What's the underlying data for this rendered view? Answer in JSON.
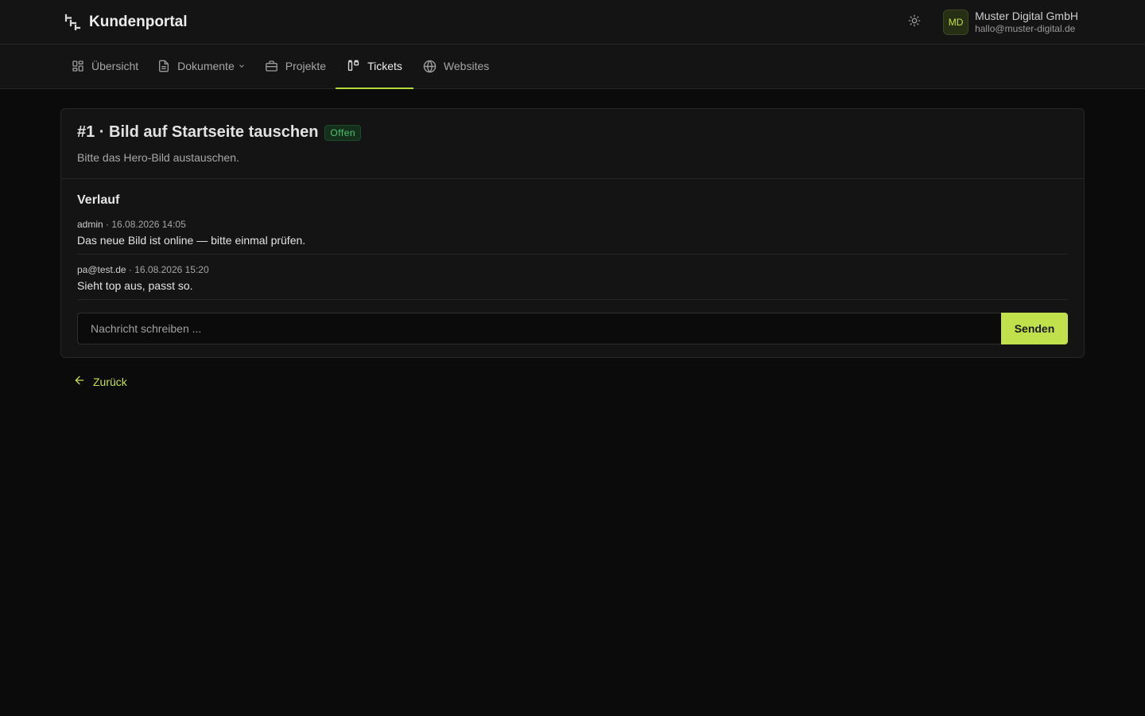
{
  "app": {
    "name": "Kundenportal",
    "logo_icon": "portal-logo-icon",
    "theme_toggle_icon": "sun-icon"
  },
  "user": {
    "initials": "MD",
    "company": "Muster Digital GmbH",
    "email": "hallo@muster-digital.de"
  },
  "nav": {
    "items": [
      {
        "label": "Übersicht",
        "icon": "dashboard-icon"
      },
      {
        "label": "Dokumente",
        "icon": "document-icon",
        "has_dropdown": true
      },
      {
        "label": "Projekte",
        "icon": "briefcase-icon"
      },
      {
        "label": "Tickets",
        "icon": "ticket-icon",
        "active": true
      },
      {
        "label": "Websites",
        "icon": "globe-icon"
      }
    ]
  },
  "ticket": {
    "title": "#1 · Bild auf Startseite tauschen",
    "status": "Offen",
    "description": "Bitte das Hero-Bild austauschen."
  },
  "history": {
    "title": "Verlauf",
    "messages": [
      {
        "author": "admin",
        "timestamp": "· 16.08.2026 14:05",
        "text": "Das neue Bild ist online — bitte einmal prüfen."
      },
      {
        "author": "pa@test.de",
        "timestamp": "· 16.08.2026 15:20",
        "text": "Sieht top aus, passt so."
      }
    ]
  },
  "composer": {
    "placeholder": "Nachricht schreiben ...",
    "send_label": "Senden"
  },
  "back": {
    "label": "Zurück"
  },
  "colors": {
    "accent": "#c0e04c",
    "status_open": "#4ec46b",
    "background": "#0b0b0b",
    "surface": "#141414"
  }
}
